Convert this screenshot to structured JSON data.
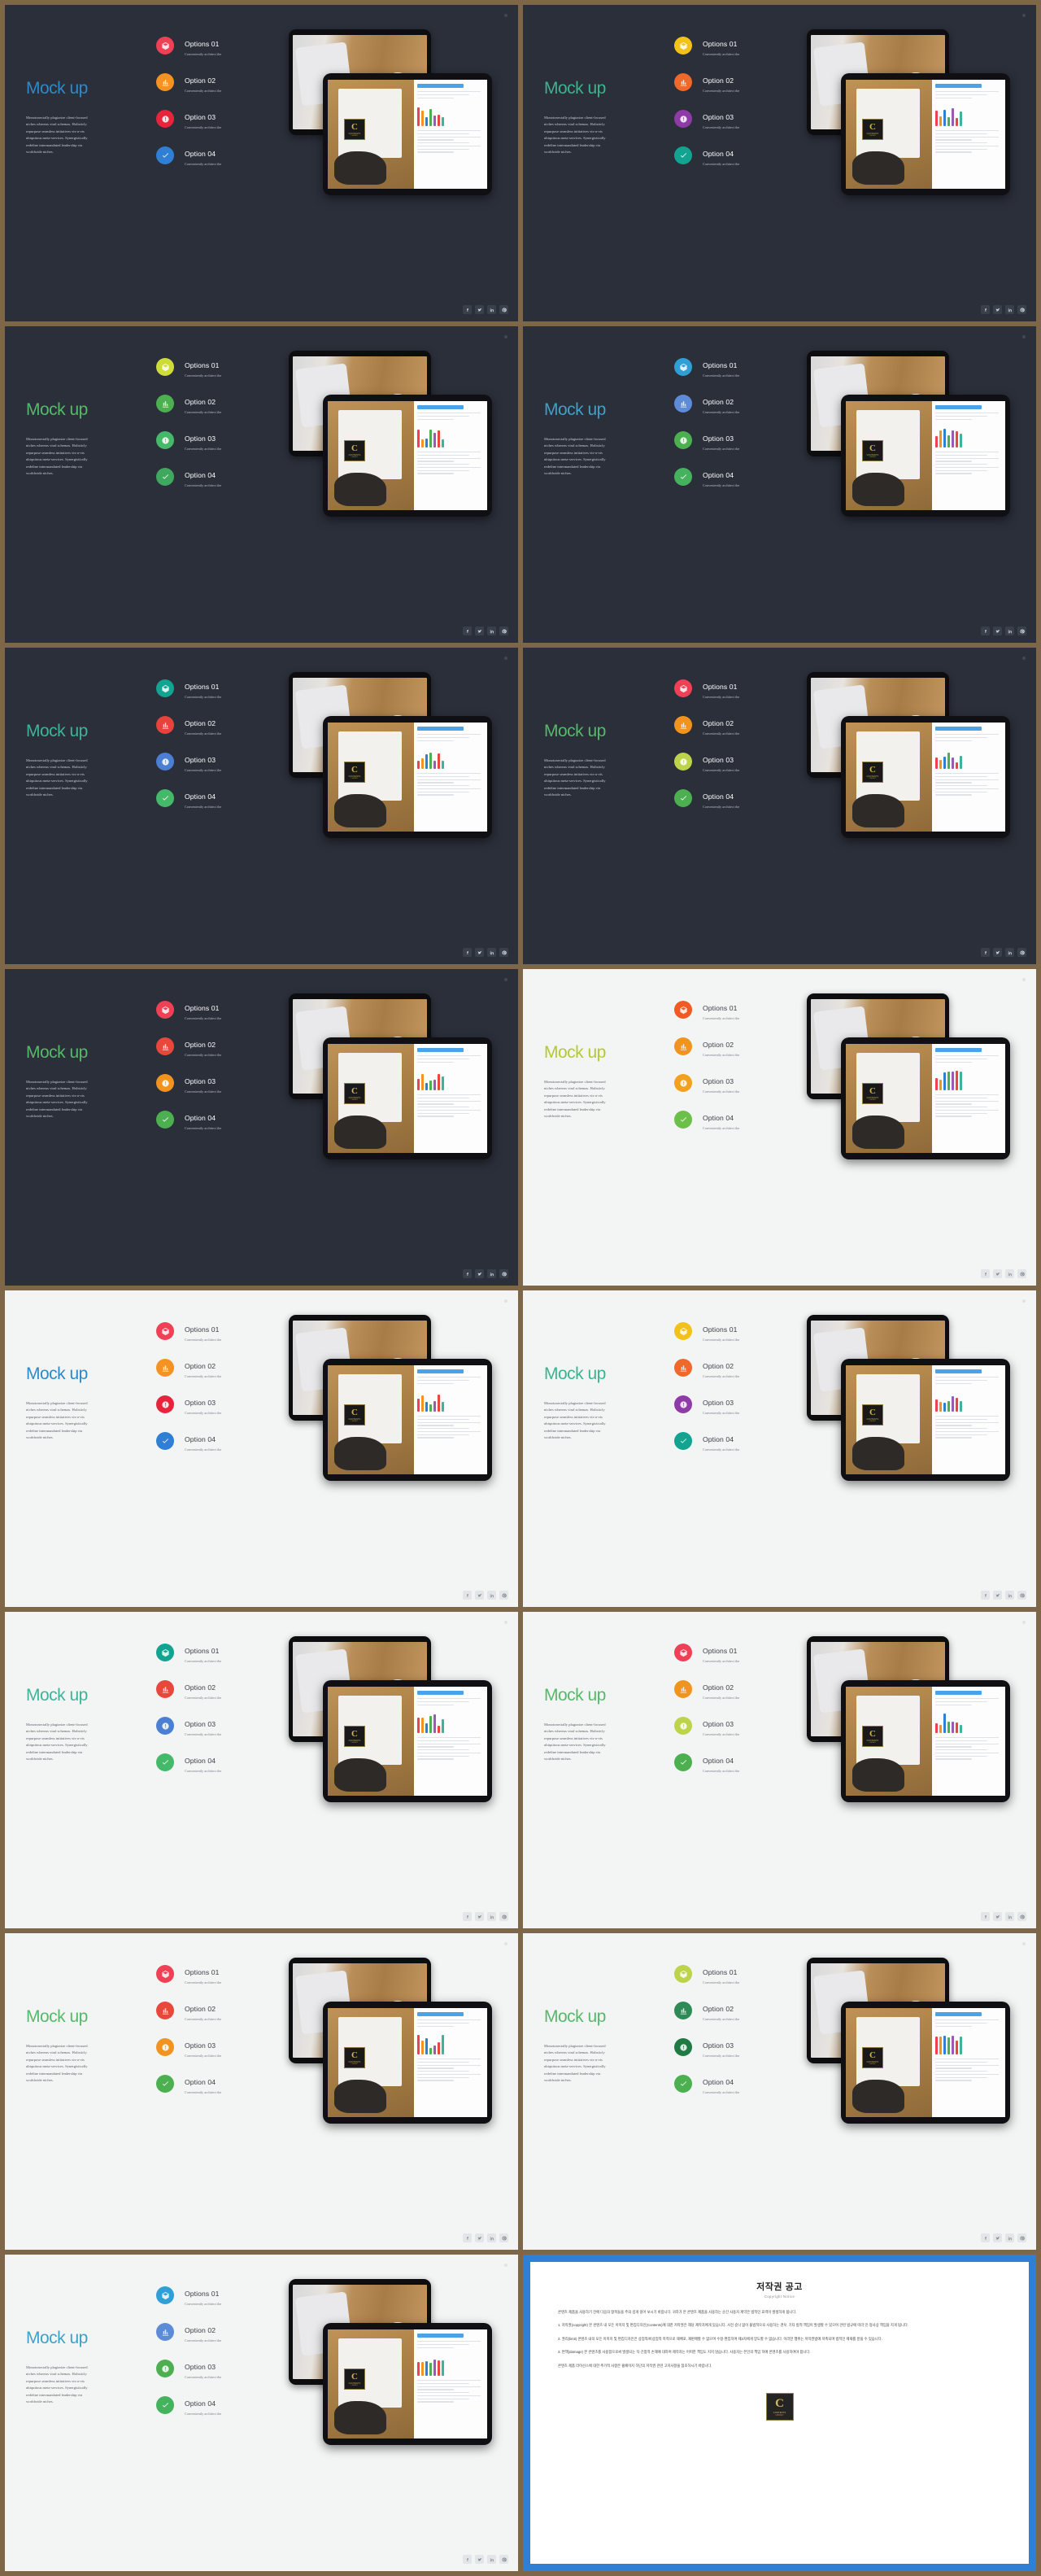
{
  "page": {
    "background_color": "#7d6748",
    "columns": 2,
    "rows": 8
  },
  "common": {
    "brand": "Mock up",
    "blurb": "Monotonectally plagiarize client-focused niches whereas viral schemas. Holisticly repurpose seamless initiatives vis-a-vis ubiquitous meta-services. Synergistically redefine intermandated leadership via worldwide niches.",
    "option_titles": [
      "Options 01",
      "Option 02",
      "Option 03",
      "Option 04"
    ],
    "option_subtitle": "Conveniently architect the",
    "social_buttons": [
      {
        "name": "facebook-icon",
        "glyph": "f"
      },
      {
        "name": "twitter-icon",
        "glyph": "t"
      },
      {
        "name": "linkedin-icon",
        "glyph": "in"
      },
      {
        "name": "pinterest-icon",
        "glyph": "p"
      }
    ],
    "badge": {
      "letter": "C",
      "line1": "CONTENTS",
      "line2": "LIBRARY"
    }
  },
  "slides": [
    {
      "index": 1,
      "theme": "dark",
      "brand_color": "#2f89c8",
      "dots": [
        "#ef4056",
        "#f59322",
        "#e8243c",
        "#2f7fd4"
      ]
    },
    {
      "index": 2,
      "theme": "dark",
      "brand_color": "#39b48e",
      "dots": [
        "#f2c21a",
        "#ef6a2a",
        "#8e3ba8",
        "#12a391"
      ]
    },
    {
      "index": 3,
      "theme": "dark",
      "brand_color": "#56b96a",
      "dots": [
        "#cddc39",
        "#4caf50",
        "#45b96a",
        "#3fa85e"
      ]
    },
    {
      "index": 4,
      "theme": "dark",
      "brand_color": "#3fa0c8",
      "dots": [
        "#2f9fd6",
        "#5e8bd8",
        "#4caf50",
        "#45b35e"
      ]
    },
    {
      "index": 5,
      "theme": "dark",
      "brand_color": "#3fb39a",
      "dots": [
        "#12a391",
        "#e8423c",
        "#4a7fd4",
        "#45b96a"
      ]
    },
    {
      "index": 6,
      "theme": "dark",
      "brand_color": "#56b96a",
      "dots": [
        "#ef4056",
        "#f1941f",
        "#bcd34a",
        "#4caf50"
      ]
    },
    {
      "index": 7,
      "theme": "dark",
      "brand_color": "#56b96a",
      "dots": [
        "#ef4056",
        "#e8483c",
        "#f1941f",
        "#4caf50"
      ]
    },
    {
      "index": 8,
      "theme": "light",
      "brand_color": "#b5c92f",
      "dots": [
        "#f15a22",
        "#f1941f",
        "#f1a01f",
        "#6cc04a"
      ]
    },
    {
      "index": 9,
      "theme": "light",
      "brand_color": "#2f89c8",
      "dots": [
        "#ef4056",
        "#f59322",
        "#e8243c",
        "#2f7fd4"
      ]
    },
    {
      "index": 10,
      "theme": "light",
      "brand_color": "#39b48e",
      "dots": [
        "#f2c21a",
        "#ef6a2a",
        "#8e3ba8",
        "#12a391"
      ]
    },
    {
      "index": 11,
      "theme": "light",
      "brand_color": "#3fb39a",
      "dots": [
        "#12a391",
        "#e8483c",
        "#4a7fd4",
        "#45b96a"
      ]
    },
    {
      "index": 12,
      "theme": "light",
      "brand_color": "#56b96a",
      "dots": [
        "#ef4056",
        "#f1941f",
        "#bcd34a",
        "#4caf50"
      ]
    },
    {
      "index": 13,
      "theme": "light",
      "brand_color": "#56b96a",
      "dots": [
        "#ef4056",
        "#e8483c",
        "#f1941f",
        "#4caf50"
      ]
    },
    {
      "index": 14,
      "theme": "light",
      "brand_color": "#56b96a",
      "dots": [
        "#bcd34a",
        "#2e8b57",
        "#1f7a44",
        "#4caf50"
      ]
    },
    {
      "index": 15,
      "theme": "light",
      "brand_color": "#3fa0c8",
      "dots": [
        "#2f9fd6",
        "#5e8bd8",
        "#4caf50",
        "#45b35e"
      ]
    }
  ],
  "copyright": {
    "title": "저작권 공고",
    "subtitle": "Copyright Notice",
    "paragraphs": [
      "콘텐츠 제품을 사용하기 전에 다음의 항목들을 주의 깊게 읽어 보시기 바랍니다. 귀하가 본 콘텐츠 제품을 사용하는 순간 사용자 계약은 법적인 효력이 발생하게 됩니다.",
      "1. 저작권(copyright) 본 콘텐츠 내 모든 이미지 및 편집디자인(Contents)에 대한 저작권은 해당 제작자에게 있습니다. 사전 승낙 없이 불법적으로 사용하는 경우, 기타 법적 책임이 발생할 수 있으며 관련 법규에 따라 민·형사상 책임을 지게 됩니다.",
      "2. 권리(limit) 콘텐츠 내의 모든 이미지 및 편집디자인은 상업적/비상업적 목적으로 재배포, 재판매할 수 없으며 수정·편집하여 제3자에게 양도할 수 없습니다. 이러한 행위는 저작권법에 저촉되며 법적인 제재를 받을 수 있습니다.",
      "3. 면책(damage) 본 콘텐츠를 사용함으로써 발생되는 직·간접적 손해에 대하여 제작자는 어떠한 책임도 지지 않습니다. 사용자는 본인의 책임 하에 콘텐츠를 사용하여야 합니다.",
      "콘텐츠 제품 라이선스에 대한 추가적 사항은 홈페이지 하단의 저작권 관련 고지사항을 참조하시기 바랍니다."
    ]
  }
}
